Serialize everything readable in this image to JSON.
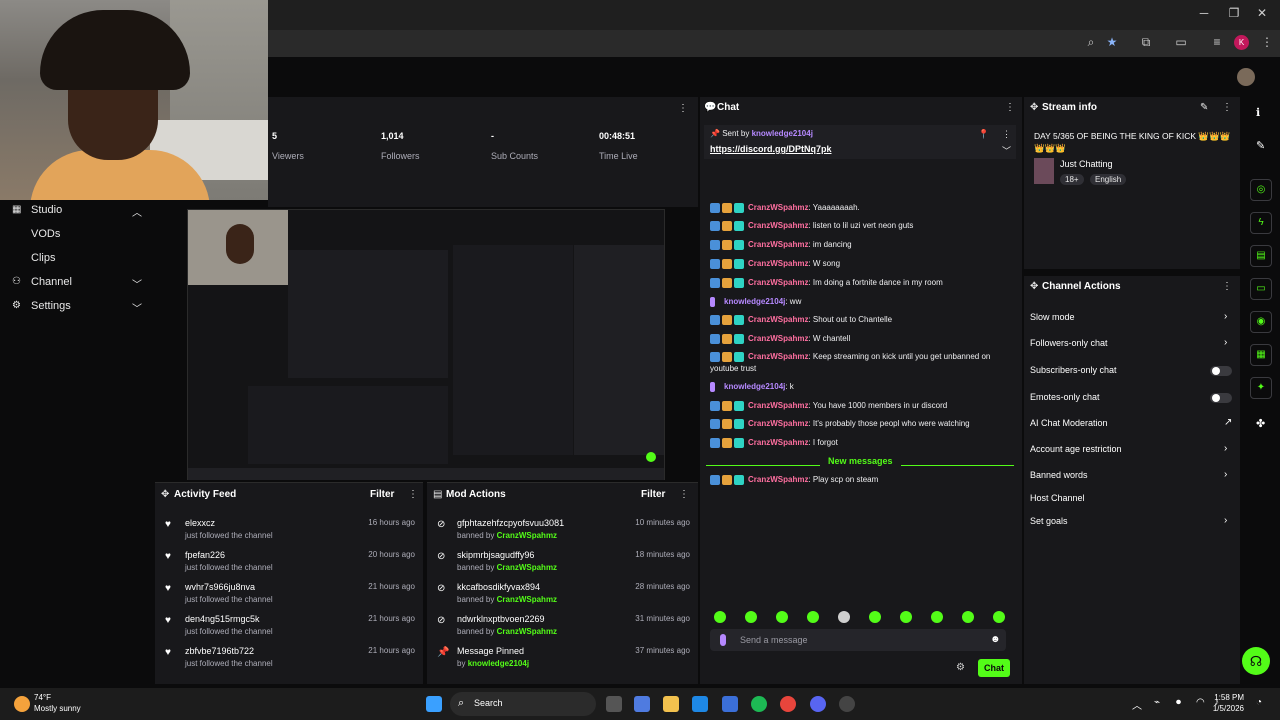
{
  "colors": {
    "accent": "#53fc18",
    "username": "#ff6fa0",
    "mod_user": "#b689ff",
    "panel": "#18181b"
  },
  "stats": [
    {
      "value": "5",
      "label": "Viewers"
    },
    {
      "value": "1,014",
      "label": "Followers"
    },
    {
      "value": "-",
      "label": "Sub Counts"
    },
    {
      "value": "00:48:51",
      "label": "Time Live"
    }
  ],
  "sidebar": {
    "items": [
      {
        "label": "Studio",
        "icon": "layout-icon"
      },
      {
        "label": "VODs"
      },
      {
        "label": "Clips"
      },
      {
        "label": "Channel",
        "icon": "user-icon"
      },
      {
        "label": "Settings",
        "icon": "gear-icon"
      }
    ]
  },
  "activity": {
    "title": "Activity Feed",
    "filter": "Filter",
    "rows": [
      {
        "name": "elexxcz",
        "sub": "just followed the channel",
        "time": "16 hours ago"
      },
      {
        "name": "fpefan226",
        "sub": "just followed the channel",
        "time": "20 hours ago"
      },
      {
        "name": "wvhr7s966ju8nva",
        "sub": "just followed the channel",
        "time": "21 hours ago"
      },
      {
        "name": "den4ng515rmgc5k",
        "sub": "just followed the channel",
        "time": "21 hours ago"
      },
      {
        "name": "zbfvbe7196tb722",
        "sub": "just followed the channel",
        "time": "21 hours ago"
      }
    ]
  },
  "mod": {
    "title": "Mod Actions",
    "filter": "Filter",
    "rows": [
      {
        "name": "gfphtazehfzcpyofsvuu3081",
        "pre": "banned by",
        "by": "CranzWSpahmz",
        "time": "10 minutes ago"
      },
      {
        "name": "skipmrbjsagudffy96",
        "pre": "banned by",
        "by": "CranzWSpahmz",
        "time": "18 minutes ago"
      },
      {
        "name": "kkcafbosdikfyvax894",
        "pre": "banned by",
        "by": "CranzWSpahmz",
        "time": "28 minutes ago"
      },
      {
        "name": "ndwrklnxptbvoen2269",
        "pre": "banned by",
        "by": "CranzWSpahmz",
        "time": "31 minutes ago"
      },
      {
        "name": "Message Pinned",
        "pre": "by",
        "by": "knowledge2104j",
        "time": "37 minutes ago"
      }
    ]
  },
  "chat": {
    "title": "Chat",
    "pinned_by_label": "Sent by",
    "pinned_user": "knowledge2104j",
    "pinned_link": "https://discord.gg/DPtNq7pk",
    "messages": [
      {
        "user": "CranzWSpahmz",
        "text": ": Yaaaaaaaah."
      },
      {
        "user": "CranzWSpahmz",
        "text": ": listen to lil uzi vert neon guts"
      },
      {
        "user": "CranzWSpahmz",
        "text": ": im dancing"
      },
      {
        "user": "CranzWSpahmz",
        "text": ": W song"
      },
      {
        "user": "CranzWSpahmz",
        "text": ": Im doing a fortnite dance in my room"
      },
      {
        "user": "knowledge2104j",
        "text": ": ww",
        "mod": true
      },
      {
        "user": "CranzWSpahmz",
        "text": ": Shout out to Chantelle"
      },
      {
        "user": "CranzWSpahmz",
        "text": ": W chantell"
      },
      {
        "user": "CranzWSpahmz",
        "text": ": Keep streaming on kick until you get unbanned on"
      },
      {
        "user": "",
        "text": "youtube trust"
      },
      {
        "user": "knowledge2104j",
        "text": ": k",
        "mod": true
      },
      {
        "user": "CranzWSpahmz",
        "text": ": You have 1000 members in ur discord"
      },
      {
        "user": "CranzWSpahmz",
        "text": ": It's probably those peopl who were watching"
      },
      {
        "user": "CranzWSpahmz",
        "text": ": I forgot"
      }
    ],
    "new_messages_label": "New messages",
    "last_message": {
      "user": "CranzWSpahmz",
      "text": ": Play scp on steam"
    },
    "placeholder": "Send a message",
    "send_label": "Chat"
  },
  "stream_info": {
    "title": "Stream info",
    "stream_title": "DAY 5/365 OF BEING THE KING OF KICK 👑👑👑👑👑👑",
    "category": "Just Chatting",
    "tags": [
      "18+",
      "English"
    ]
  },
  "channel_actions": {
    "title": "Channel Actions",
    "items": [
      {
        "label": "Slow mode",
        "control": "chevron"
      },
      {
        "label": "Followers-only chat",
        "control": "chevron"
      },
      {
        "label": "Subscribers-only chat",
        "control": "toggle"
      },
      {
        "label": "Emotes-only chat",
        "control": "toggle"
      },
      {
        "label": "AI Chat Moderation",
        "control": "external"
      },
      {
        "label": "Account age restriction",
        "control": "chevron"
      },
      {
        "label": "Banned words",
        "control": "chevron"
      },
      {
        "label": "Host Channel",
        "control": "none"
      },
      {
        "label": "Set goals",
        "control": "chevron"
      }
    ]
  },
  "taskbar": {
    "weather_temp": "74°F",
    "weather_desc": "Mostly sunny",
    "search_label": "Search",
    "time": "1:58 PM",
    "date": "1/5/2026"
  }
}
